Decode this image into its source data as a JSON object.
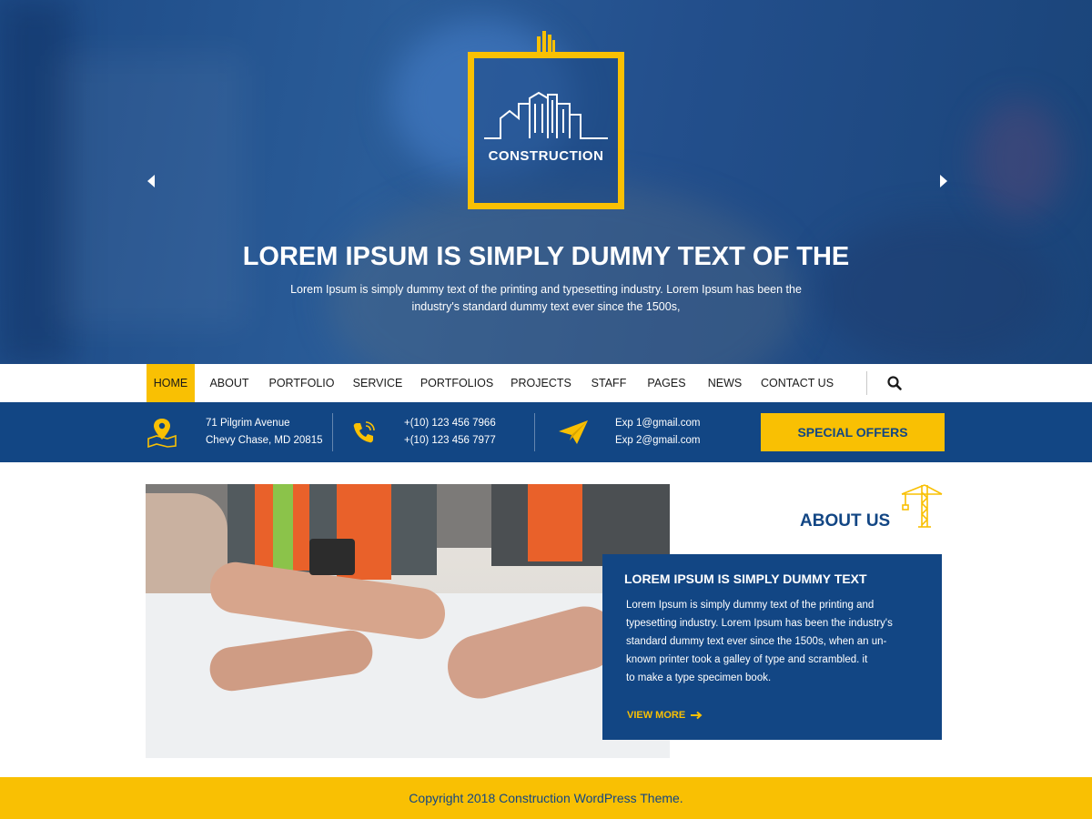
{
  "colors": {
    "brand_blue": "#124684",
    "accent_yellow": "#f9c003",
    "white": "#ffffff"
  },
  "hero": {
    "logo_text": "CONSTRUCTION",
    "title": "LOREM IPSUM IS SIMPLY DUMMY TEXT OF THE",
    "subtitle_line1": "Lorem Ipsum is simply dummy text of the printing and typesetting industry. Lorem Ipsum has been the",
    "subtitle_line2": "industry's standard dummy text ever since the 1500s,",
    "prev_icon": "chevron-left-icon",
    "next_icon": "chevron-right-icon"
  },
  "nav": {
    "items": [
      {
        "label": "HOME",
        "active": true
      },
      {
        "label": "ABOUT",
        "active": false
      },
      {
        "label": "PORTFOLIO",
        "active": false
      },
      {
        "label": "SERVICE",
        "active": false
      },
      {
        "label": "PORTFOLIOS",
        "active": false
      },
      {
        "label": "PROJECTS",
        "active": false
      },
      {
        "label": "STAFF",
        "active": false
      },
      {
        "label": "PAGES",
        "active": false
      },
      {
        "label": "NEWS",
        "active": false
      },
      {
        "label": "CONTACT US",
        "active": false
      }
    ],
    "search_icon": "search-icon"
  },
  "info": {
    "address": {
      "icon": "map-pin-icon",
      "line1": "71 Pilgrim Avenue",
      "line2": "Chevy Chase, MD 20815"
    },
    "phone": {
      "icon": "phone-icon",
      "line1": "+(10) 123 456 7966",
      "line2": "+(10) 123 456 7977"
    },
    "email": {
      "icon": "paper-plane-icon",
      "line1": "Exp 1@gmail.com",
      "line2": "Exp 2@gmail.com"
    },
    "offer_button": "SPECIAL OFFERS"
  },
  "about": {
    "title": "ABOUT US",
    "title_icon": "crane-icon",
    "card_title": "LOREM IPSUM IS SIMPLY DUMMY TEXT",
    "body_lines": [
      "Lorem Ipsum is simply dummy text of the printing and",
      "typesetting industry. Lorem Ipsum has been the industry's",
      "standard dummy text ever since the 1500s, when an un-",
      "known printer took a galley of type and scrambled. it",
      "to make a type specimen book."
    ],
    "view_more": "VIEW MORE",
    "view_more_icon": "arrow-right-icon"
  },
  "footer": {
    "copyright": "Copyright 2018 Construction WordPress Theme."
  }
}
